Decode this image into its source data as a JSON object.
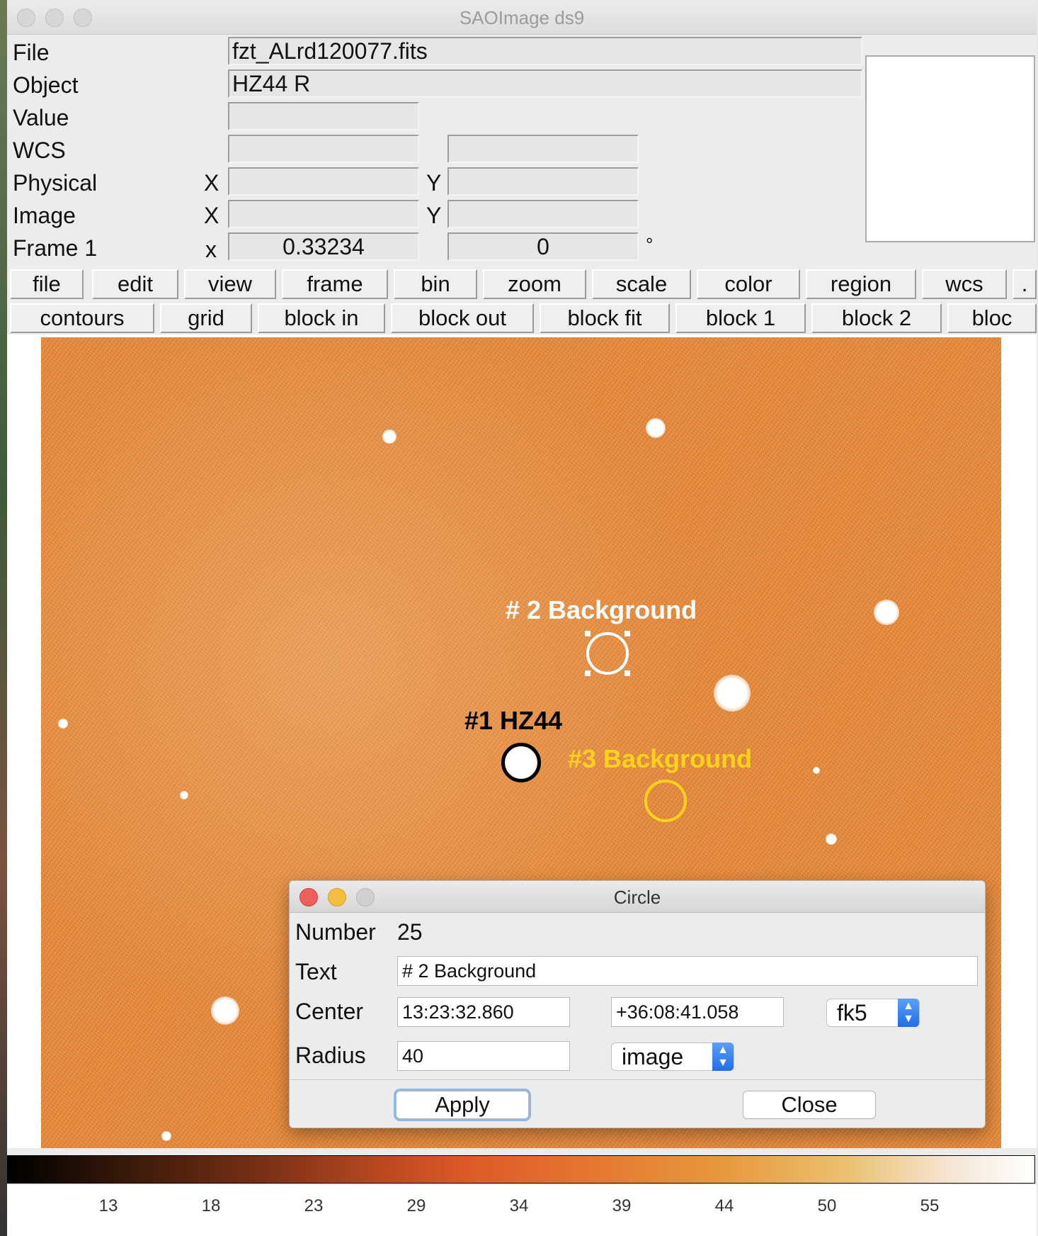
{
  "window": {
    "title": "SAOImage ds9"
  },
  "info": {
    "file_label": "File",
    "file_value": "fzt_ALrd120077.fits",
    "object_label": "Object",
    "object_value": "HZ44 R",
    "value_label": "Value",
    "wcs_label": "WCS",
    "physical_label": "Physical",
    "image_label": "Image",
    "frame_label": "Frame 1",
    "x_upper": "X",
    "y_upper": "Y",
    "x_lower": "x",
    "frame_x_value": "0.33234",
    "frame_y_value": "0",
    "degree_symbol": "°"
  },
  "menu_buttons": [
    "file",
    "edit",
    "view",
    "frame",
    "bin",
    "zoom",
    "scale",
    "color",
    "region",
    "wcs",
    "."
  ],
  "sub_buttons": [
    "contours",
    "grid",
    "block in",
    "block out",
    "block fit",
    "block 1",
    "block 2",
    "bloc"
  ],
  "regions": {
    "r1": {
      "label": "#1 HZ44",
      "color": "#000000"
    },
    "r2": {
      "label": "# 2 Background",
      "color": "#ffffff"
    },
    "r3": {
      "label": "#3 Background",
      "color": "#ffd21e"
    }
  },
  "dialog": {
    "title": "Circle",
    "number_label": "Number",
    "number_value": "25",
    "text_label": "Text",
    "text_value": "# 2 Background",
    "center_label": "Center",
    "center_ra": "13:23:32.860",
    "center_dec": "+36:08:41.058",
    "center_system": "fk5",
    "radius_label": "Radius",
    "radius_value": "40",
    "radius_units": "image",
    "apply_label": "Apply",
    "close_label": "Close"
  },
  "colorbar": {
    "ticks": [
      "13",
      "18",
      "23",
      "29",
      "34",
      "39",
      "44",
      "50",
      "55"
    ]
  },
  "colors": {
    "image_base": "#e48535",
    "accent_blue": "#1e6fe8"
  }
}
